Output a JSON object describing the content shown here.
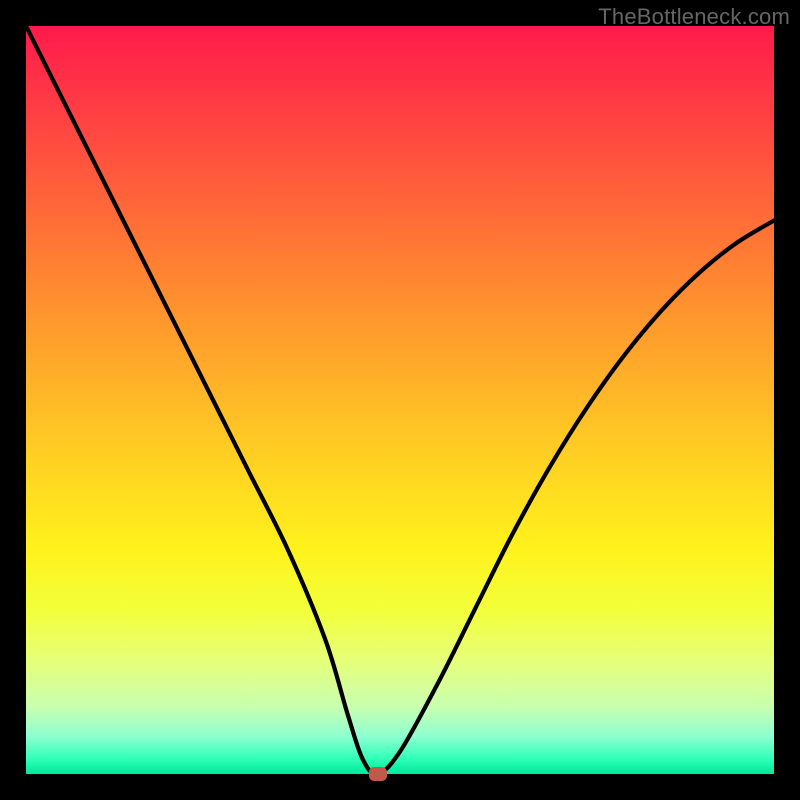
{
  "watermark": "TheBottleneck.com",
  "colors": {
    "frame": "#000000",
    "gradient_top": "#ff1a4b",
    "gradient_bottom": "#00e89a",
    "curve": "#000000",
    "marker": "#c05a4a"
  },
  "chart_data": {
    "type": "line",
    "title": "",
    "xlabel": "",
    "ylabel": "",
    "xlim": [
      0,
      100
    ],
    "ylim": [
      0,
      100
    ],
    "x": [
      0,
      5,
      10,
      15,
      20,
      25,
      30,
      35,
      40,
      43,
      45,
      47,
      50,
      55,
      60,
      65,
      70,
      75,
      80,
      85,
      90,
      95,
      100
    ],
    "values": [
      100,
      90,
      80,
      70,
      60,
      50,
      40,
      30,
      18,
      8,
      2,
      0,
      3,
      12,
      22,
      32,
      41,
      49,
      56,
      62,
      67,
      71,
      74
    ],
    "min_point": {
      "x": 47,
      "y": 0
    },
    "annotations": [],
    "legend": []
  }
}
